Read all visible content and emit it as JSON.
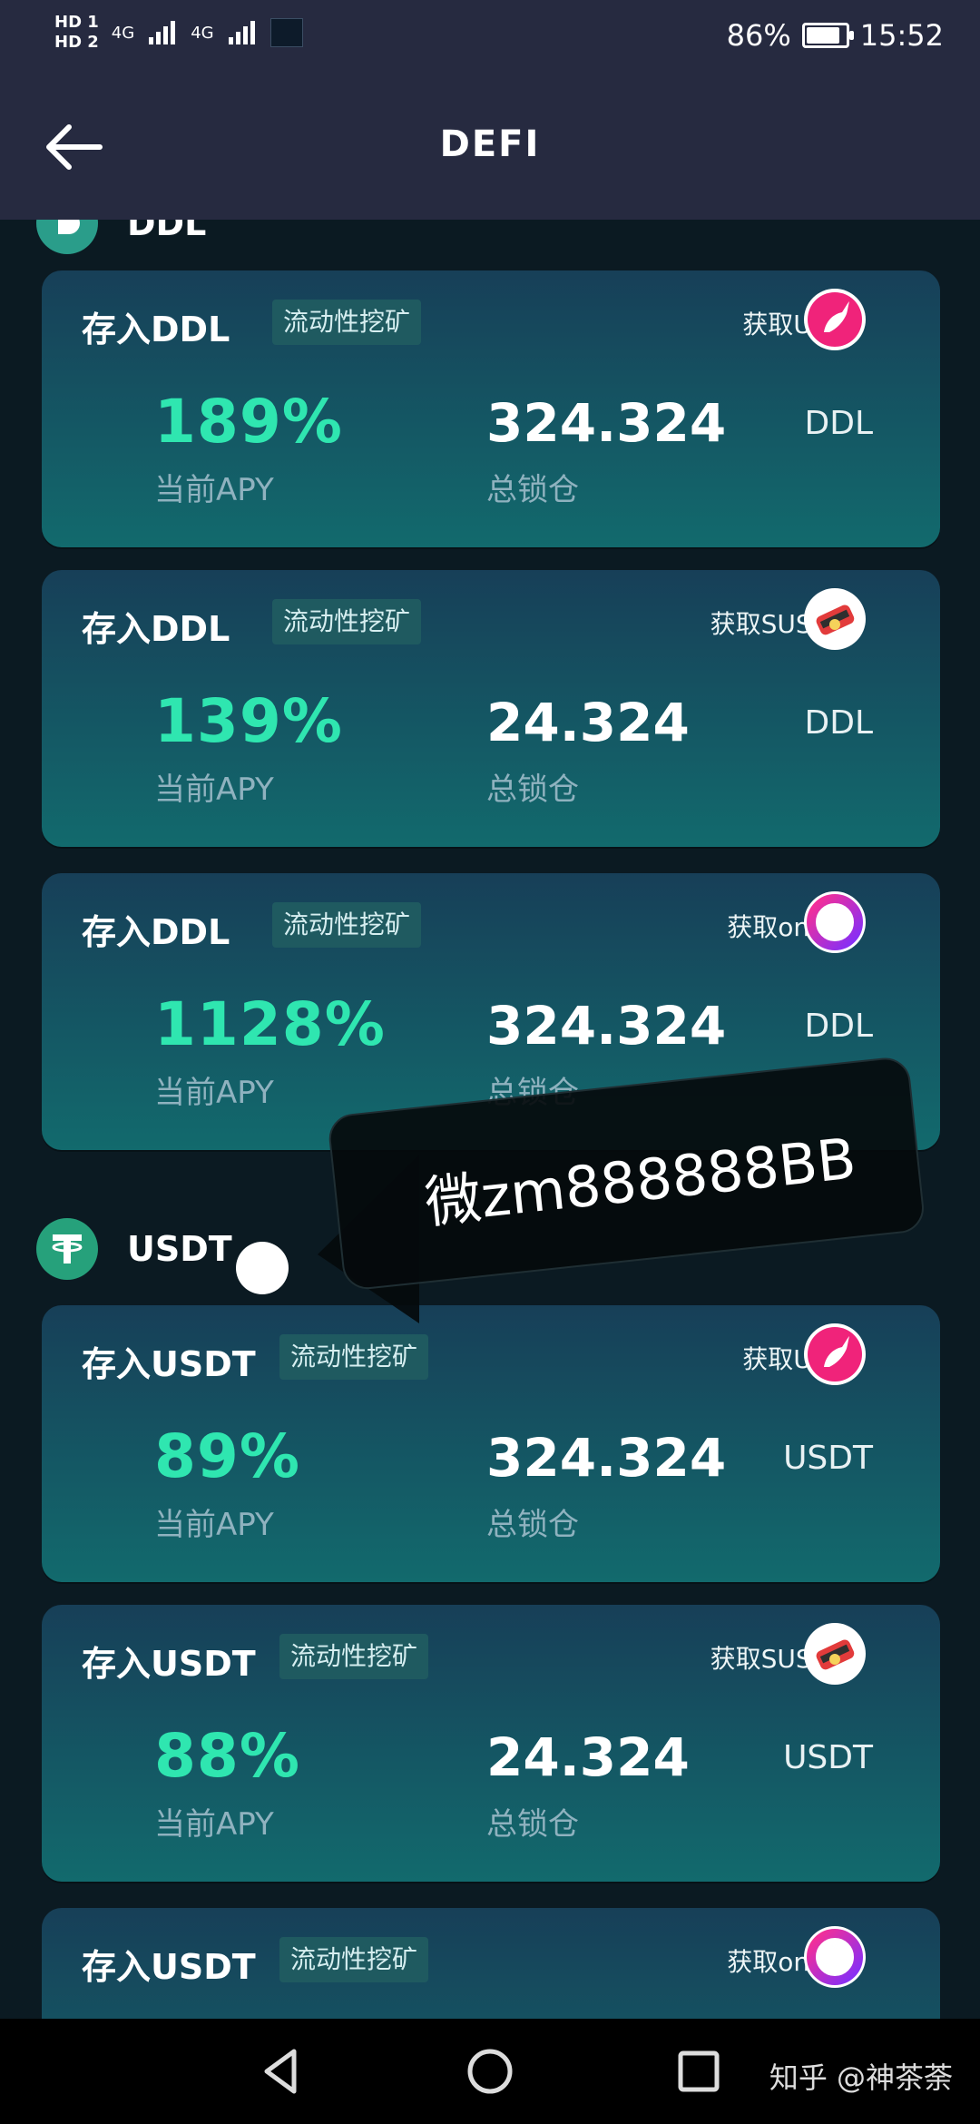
{
  "status_bar": {
    "hd1": "HD 1",
    "hd2": "HD 2",
    "net1": "4G",
    "net2": "4G",
    "battery_percent_text": "86%",
    "battery_level": 0.86,
    "time": "15:52"
  },
  "header": {
    "title": "DEFI"
  },
  "colors": {
    "apy": "#2fe6b0",
    "card_top": "#173f58",
    "card_bottom": "#126a6d",
    "header_bg": "#262a40",
    "usdt_green": "#26a17b"
  },
  "sections": {
    "ddl": {
      "title": "DDL"
    },
    "usdt": {
      "title": "USDT"
    }
  },
  "cards": [
    {
      "deposit": "存入DDL",
      "tag": "流动性挖矿",
      "earn": "获取UNI",
      "icon": "uniswap-icon",
      "apy": "189%",
      "apy_label": "当前APY",
      "tvl": "324.324",
      "tvl_label": "总锁仓",
      "unit": "DDL"
    },
    {
      "deposit": "存入DDL",
      "tag": "流动性挖矿",
      "earn": "获取SUSHI",
      "icon": "sushi-icon",
      "apy": "139%",
      "apy_label": "当前APY",
      "tvl": "24.324",
      "tvl_label": "总锁仓",
      "unit": "DDL"
    },
    {
      "deposit": "存入DDL",
      "tag": "流动性挖矿",
      "earn": "获取ones",
      "icon": "ones-icon",
      "apy": "1128%",
      "apy_label": "当前APY",
      "tvl": "324.324",
      "tvl_label": "总锁仓",
      "unit": "DDL"
    },
    {
      "deposit": "存入USDT",
      "tag": "流动性挖矿",
      "earn": "获取UNI",
      "icon": "uniswap-icon",
      "apy": "89%",
      "apy_label": "当前APY",
      "tvl": "324.324",
      "tvl_label": "总锁仓",
      "unit": "USDT"
    },
    {
      "deposit": "存入USDT",
      "tag": "流动性挖矿",
      "earn": "获取SUSHI",
      "icon": "sushi-icon",
      "apy": "88%",
      "apy_label": "当前APY",
      "tvl": "24.324",
      "tvl_label": "总锁仓",
      "unit": "USDT"
    },
    {
      "deposit": "存入USDT",
      "tag": "流动性挖矿",
      "earn": "获取ones",
      "icon": "ones-icon"
    }
  ],
  "overlay": {
    "text": "微zm888888BB"
  },
  "nav": {
    "watermark": "知乎 @神茶荼"
  }
}
